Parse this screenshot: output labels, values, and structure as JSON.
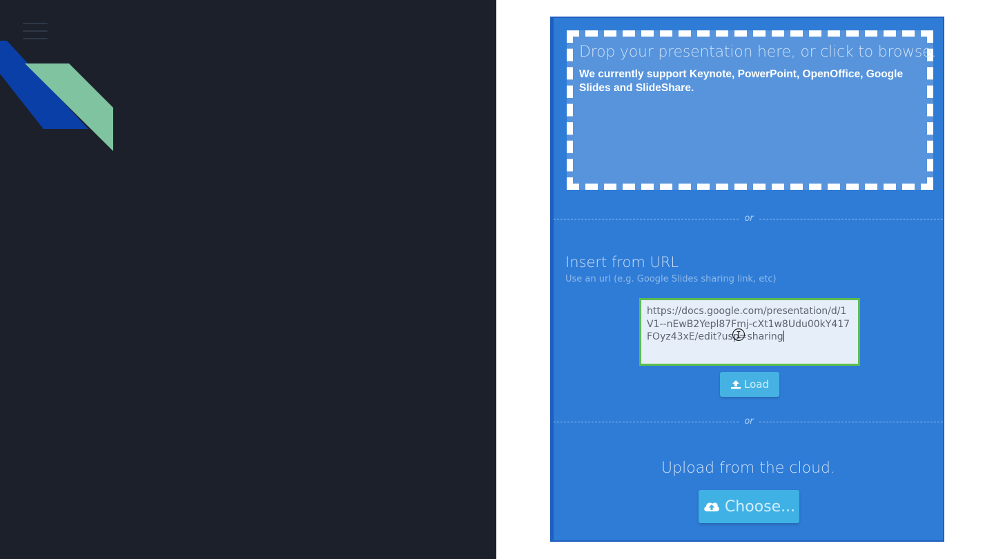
{
  "sidebar": {
    "menu_icon": "hamburger-menu-icon",
    "logo_icon": "diagonal-stripes-logo",
    "background": "#1b202a"
  },
  "upload": {
    "dropzone": {
      "title": "Drop your presentation here, or click to browse.",
      "support_text": "We currently support Keynote, PowerPoint, OpenOffice, Google Slides and SlideShare."
    },
    "divider_text": "or",
    "url_section": {
      "title": "Insert from URL",
      "hint": "Use an url (e.g. Google Slides sharing link, etc)",
      "input_value": "https://docs.google.com/presentation/d/1V1--nEwB2Yepl87Fmj-cXt1w8Udu00kY417FOyz43xE/edit?usp=sharing",
      "load_label": "Load",
      "load_icon": "upload-icon"
    },
    "cloud_section": {
      "title": "Upload from the cloud.",
      "choose_label": "Choose...",
      "choose_icon": "cloud-upload-icon"
    }
  },
  "colors": {
    "dialog_bg": "#2f7cd7",
    "dropzone_bg": "#5794dc",
    "button_bg": "#45b2e3",
    "input_border": "#5cbe4c",
    "logo_blue": "#0a3fa8",
    "logo_green": "#7fc3a0"
  }
}
